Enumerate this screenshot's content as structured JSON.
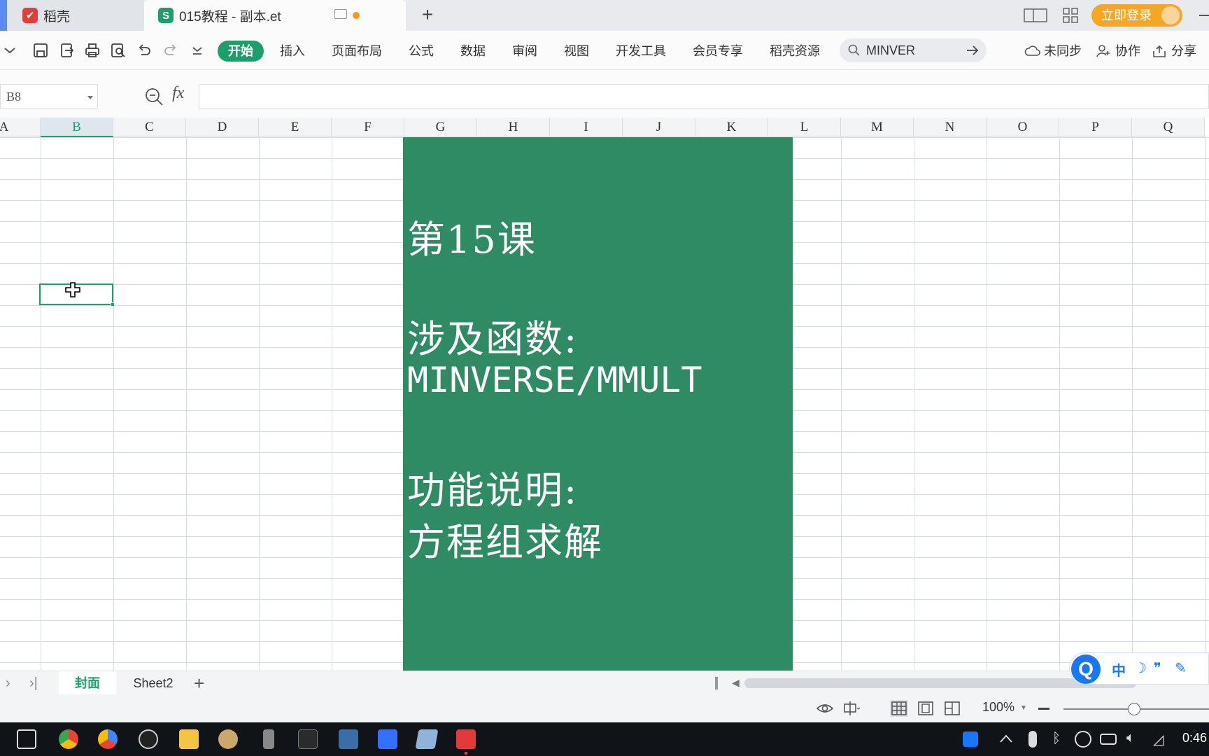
{
  "titlebar": {
    "tab_daoke": "稻壳",
    "tab_file": "015教程 - 副本.et",
    "file_logo": "S",
    "new_tab": "+",
    "login": "立即登录"
  },
  "ribbon": {
    "menus": [
      "开始",
      "插入",
      "页面布局",
      "公式",
      "数据",
      "审阅",
      "视图",
      "开发工具",
      "会员专享",
      "稻壳资源"
    ],
    "search_value": "MINVER",
    "unsynced": "未同步",
    "collab": "协作",
    "share": "分享"
  },
  "formula": {
    "cell_ref": "B8",
    "fx": "fx",
    "content": ""
  },
  "grid": {
    "columns": [
      "A",
      "B",
      "C",
      "D",
      "E",
      "F",
      "G",
      "H",
      "I",
      "J",
      "K",
      "L",
      "M",
      "N",
      "O",
      "P",
      "Q"
    ],
    "selected_column": "B",
    "selected_cell": "B8",
    "banner": {
      "line1": "第15课",
      "line2": "涉及函数:",
      "line3": "MINVERSE/MMULT",
      "line4": "功能说明:",
      "line5": "方程组求解",
      "background": "#2e8b64"
    }
  },
  "sheets": {
    "tabs": [
      "封面",
      "Sheet2"
    ],
    "active": "封面",
    "add": "+"
  },
  "ime": {
    "logo": "Q",
    "mode": "中"
  },
  "status": {
    "zoom": "100%"
  },
  "taskbar": {
    "clock": "0:46",
    "apps": [
      "task-view",
      "chrome",
      "chrome-alt",
      "obs",
      "file-explorer",
      "paint",
      "recorder",
      "terminal",
      "calculator",
      "feishu",
      "notes",
      "wps"
    ]
  },
  "colors": {
    "accent": "#1e9e6b",
    "login": "#f5a623",
    "banner": "#2e8b64"
  }
}
